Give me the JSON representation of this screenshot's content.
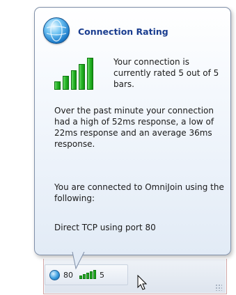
{
  "tooltip": {
    "title": "Connection Rating",
    "rating_text": "Your connection is currently rated 5 out of 5 bars.",
    "rating": 5,
    "rating_max": 5,
    "stats_text": "Over the past minute your connection had a high of 52ms response, a low of 22ms response and an average 36ms response.",
    "connection_intro": "You are connected to OmniJoin using the following:",
    "connection_method": "Direct TCP using port 80"
  },
  "status_bar": {
    "port": "80",
    "bars_count": "5"
  },
  "colors": {
    "title": "#1a3d8f",
    "bars_green": "#27b527",
    "balloon_border": "#7f8fa8"
  },
  "icons": [
    "globe-icon",
    "signal-bars-icon",
    "resize-grip-icon",
    "mouse-cursor-icon"
  ]
}
